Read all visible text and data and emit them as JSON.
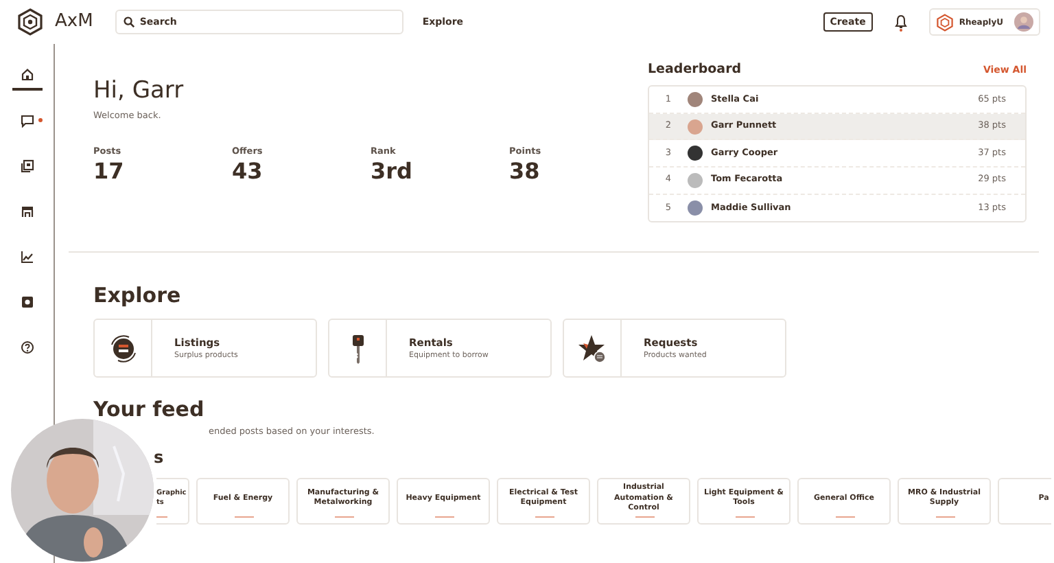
{
  "app": {
    "name": "AxM"
  },
  "search": {
    "placeholder": "Search"
  },
  "nav_link": "Explore",
  "create_button": "Create",
  "notifications": {
    "unread": true
  },
  "account": {
    "name": "RheaplyU"
  },
  "sidebar": {
    "items": [
      {
        "kind": "home",
        "selected": true,
        "badge": false
      },
      {
        "kind": "chat",
        "selected": false,
        "badge": true
      },
      {
        "kind": "listings",
        "selected": false,
        "badge": false
      },
      {
        "kind": "store",
        "selected": false,
        "badge": false
      },
      {
        "kind": "chart",
        "selected": false,
        "badge": false
      },
      {
        "kind": "settings",
        "selected": false,
        "badge": false
      },
      {
        "kind": "help",
        "selected": false,
        "badge": false
      }
    ]
  },
  "greeting": {
    "title": "Hi, Garr",
    "subtitle": "Welcome back."
  },
  "stats": [
    {
      "label": "Posts",
      "value": "17"
    },
    {
      "label": "Offers",
      "value": "43"
    },
    {
      "label": "Rank",
      "value": "3rd"
    },
    {
      "label": "Points",
      "value": "38"
    }
  ],
  "leaderboard": {
    "title": "Leaderboard",
    "link": "View All",
    "rows": [
      {
        "rank": "1",
        "name": "Stella Cai",
        "points": "65 pts",
        "selected": false
      },
      {
        "rank": "2",
        "name": "Garr Punnett",
        "points": "38 pts",
        "selected": true
      },
      {
        "rank": "3",
        "name": "Garry Cooper",
        "points": "37 pts",
        "selected": false
      },
      {
        "rank": "4",
        "name": "Tom Fecarotta",
        "points": "29 pts",
        "selected": false
      },
      {
        "rank": "5",
        "name": "Maddie Sullivan",
        "points": "13 pts",
        "selected": false
      }
    ]
  },
  "explore": {
    "title": "Explore",
    "cards": [
      {
        "kind": "listings",
        "title": "Listings",
        "subtitle": "Surplus products"
      },
      {
        "kind": "rentals",
        "title": "Rentals",
        "subtitle": "Equipment to borrow"
      },
      {
        "kind": "requests",
        "title": "Requests",
        "subtitle": "Products wanted"
      }
    ]
  },
  "feed": {
    "title": "Your feed",
    "subtitle": "ended posts based on your interests."
  },
  "categories": {
    "title": "s",
    "chips": [
      "Graphic ts",
      "Fuel & Energy",
      "Manufacturing & Metalworking",
      "Heavy Equipment",
      "Electrical & Test Equipment",
      "Industrial Automation & Control",
      "Light Equipment & Tools",
      "General Office",
      "MRO & Industrial Supply",
      "Pa"
    ]
  }
}
